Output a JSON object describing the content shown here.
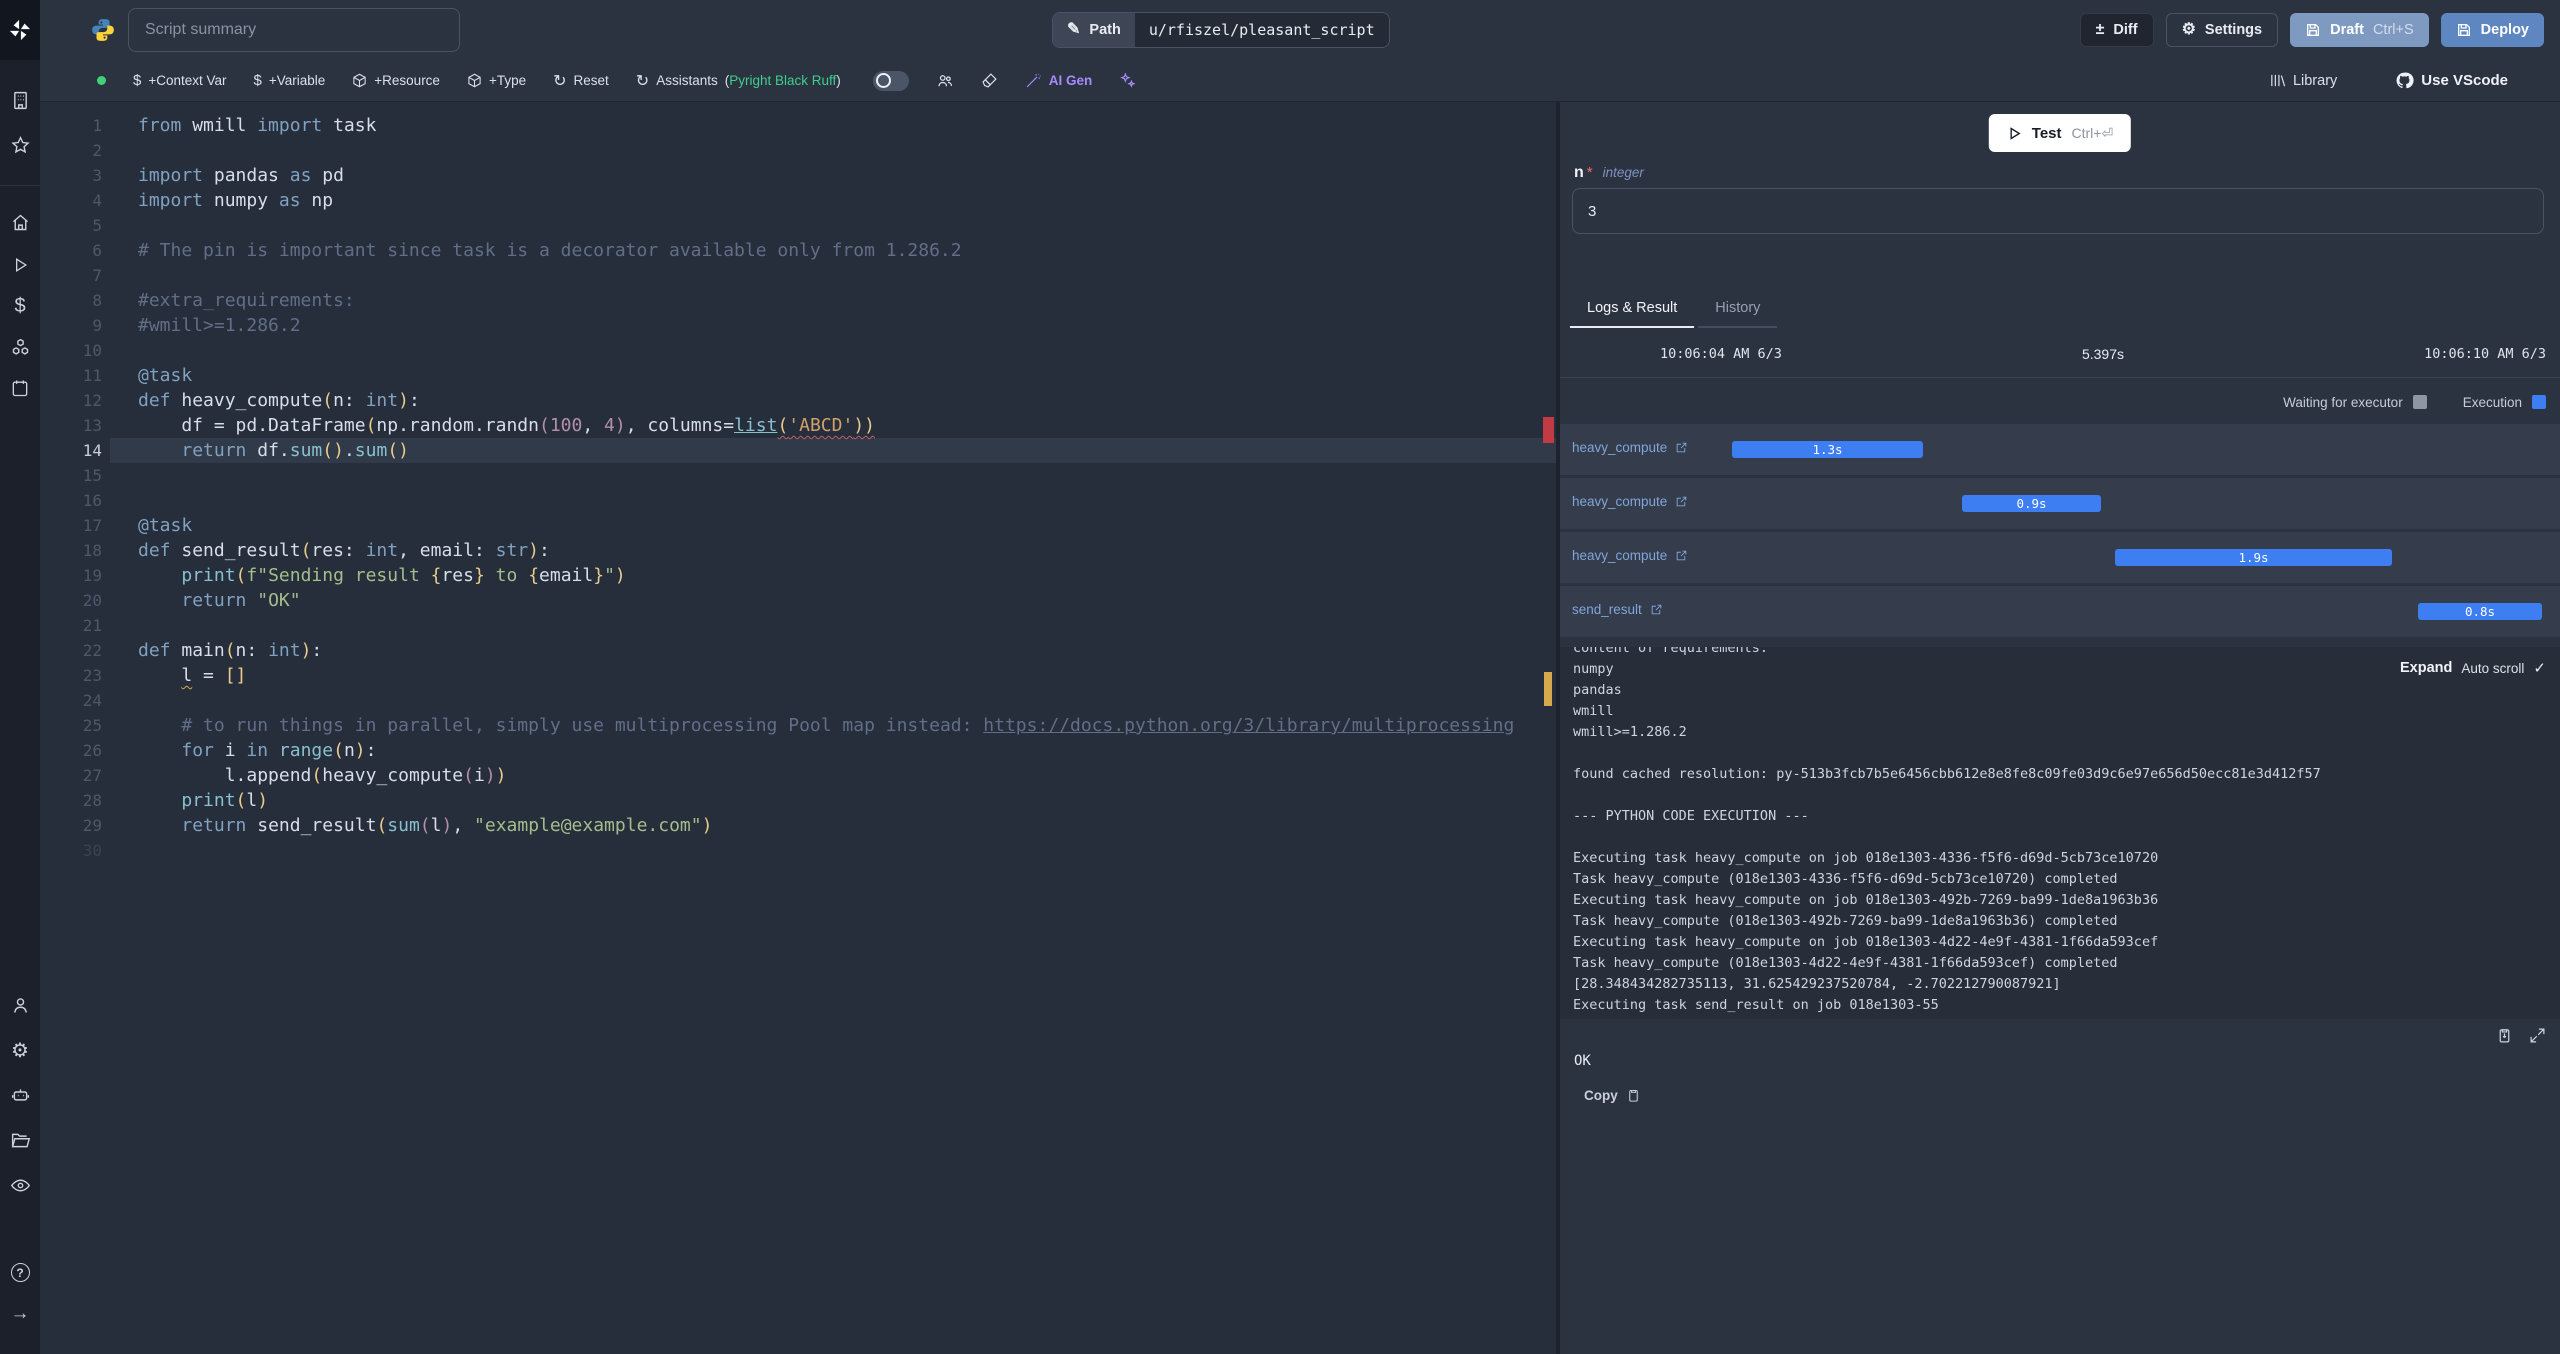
{
  "header": {
    "title_placeholder": "Script summary",
    "path_label": "Path",
    "path_value": "u/rfiszel/pleasant_script",
    "diff_label": "Diff",
    "settings_label": "Settings",
    "draft_label": "Draft",
    "draft_shortcut": "Ctrl+S",
    "deploy_label": "Deploy"
  },
  "toolbar": {
    "context_var": "+Context Var",
    "variable": "+Variable",
    "resource": "+Resource",
    "type": "+Type",
    "reset": "Reset",
    "assistants": "Assistants",
    "assistants_open": "(",
    "assistants_note": "Pyright Black Ruff",
    "assistants_close": ")",
    "ai_gen": "AI Gen",
    "library": "Library",
    "use_vscode": "Use VScode"
  },
  "editor": {
    "current_line": 14,
    "dim_lines": [
      30
    ],
    "lines": [
      [
        [
          "k",
          "from"
        ],
        [
          "t",
          " wmill "
        ],
        [
          "k",
          "import"
        ],
        [
          "t",
          " task"
        ]
      ],
      [],
      [
        [
          "k",
          "import"
        ],
        [
          "t",
          " pandas "
        ],
        [
          "k",
          "as"
        ],
        [
          "t",
          " pd"
        ]
      ],
      [
        [
          "k",
          "import"
        ],
        [
          "t",
          " numpy "
        ],
        [
          "k",
          "as"
        ],
        [
          "t",
          " np"
        ]
      ],
      [],
      [
        [
          "c",
          "# The pin is important since task is a decorator available only from 1.286.2"
        ]
      ],
      [],
      [
        [
          "c",
          "#extra_requirements:"
        ]
      ],
      [
        [
          "c",
          "#wmill>=1.286.2"
        ]
      ],
      [],
      [
        [
          "d",
          "@task"
        ]
      ],
      [
        [
          "k",
          "def"
        ],
        [
          "t",
          " heavy_compute"
        ],
        [
          "y",
          "("
        ],
        [
          "t",
          "n: "
        ],
        [
          "k",
          "int"
        ],
        [
          "y",
          ")"
        ],
        [
          "t",
          ":"
        ]
      ],
      [
        [
          "t",
          "    df = pd.DataFrame"
        ],
        [
          "y",
          "("
        ],
        [
          "t",
          "np.random.randn"
        ],
        [
          "p",
          "("
        ],
        [
          "n",
          "100"
        ],
        [
          "t",
          ", "
        ],
        [
          "n",
          "4"
        ],
        [
          "p",
          ")"
        ],
        [
          "t",
          ", columns="
        ],
        [
          "lk",
          "list"
        ],
        [
          "y sqr",
          "("
        ],
        [
          "o sqr",
          "'ABCD'"
        ],
        [
          "y sqr",
          "))"
        ]
      ],
      [
        [
          "t",
          "    "
        ],
        [
          "k",
          "return"
        ],
        [
          "t",
          " df."
        ],
        [
          "f",
          "sum"
        ],
        [
          "y",
          "()"
        ],
        [
          "t",
          "."
        ],
        [
          "f",
          "sum"
        ],
        [
          "y",
          "()"
        ]
      ],
      [],
      [],
      [
        [
          "d",
          "@task"
        ]
      ],
      [
        [
          "k",
          "def"
        ],
        [
          "t",
          " send_result"
        ],
        [
          "y",
          "("
        ],
        [
          "t",
          "res: "
        ],
        [
          "k",
          "int"
        ],
        [
          "t",
          ", email: "
        ],
        [
          "k",
          "str"
        ],
        [
          "y",
          ")"
        ],
        [
          "t",
          ":"
        ]
      ],
      [
        [
          "t",
          "    "
        ],
        [
          "f",
          "print"
        ],
        [
          "y",
          "("
        ],
        [
          "s",
          "f\"Sending result "
        ],
        [
          "y",
          "{"
        ],
        [
          "t",
          "res"
        ],
        [
          "y",
          "}"
        ],
        [
          "s",
          " to "
        ],
        [
          "y",
          "{"
        ],
        [
          "t",
          "email"
        ],
        [
          "y",
          "}"
        ],
        [
          "s",
          "\""
        ],
        [
          "y",
          ")"
        ]
      ],
      [
        [
          "t",
          "    "
        ],
        [
          "k",
          "return"
        ],
        [
          "s",
          " \"OK\""
        ]
      ],
      [],
      [
        [
          "k",
          "def"
        ],
        [
          "t",
          " main"
        ],
        [
          "y",
          "("
        ],
        [
          "t",
          "n: "
        ],
        [
          "k",
          "int"
        ],
        [
          "y",
          ")"
        ],
        [
          "t",
          ":"
        ]
      ],
      [
        [
          "t",
          "    "
        ],
        [
          "t sqy",
          "l"
        ],
        [
          "t",
          " = "
        ],
        [
          "y",
          "[]"
        ]
      ],
      [],
      [
        [
          "t",
          "    "
        ],
        [
          "c",
          "# to run things in parallel, simply use multiprocessing Pool map instead: "
        ],
        [
          "u",
          "https://docs.python.org/3/library/multiprocessing"
        ]
      ],
      [
        [
          "t",
          "    "
        ],
        [
          "k",
          "for"
        ],
        [
          "t",
          " i "
        ],
        [
          "k",
          "in"
        ],
        [
          "t",
          " "
        ],
        [
          "f",
          "range"
        ],
        [
          "y",
          "("
        ],
        [
          "t",
          "n"
        ],
        [
          "y",
          ")"
        ],
        [
          "t",
          ":"
        ]
      ],
      [
        [
          "t",
          "        l."
        ],
        [
          "t",
          "append"
        ],
        [
          "y",
          "("
        ],
        [
          "t",
          "heavy_compute"
        ],
        [
          "p",
          "("
        ],
        [
          "t",
          "i"
        ],
        [
          "p",
          ")"
        ],
        [
          "y",
          ")"
        ]
      ],
      [
        [
          "t",
          "    "
        ],
        [
          "f",
          "print"
        ],
        [
          "y",
          "("
        ],
        [
          "t",
          "l"
        ],
        [
          "y",
          ")"
        ]
      ],
      [
        [
          "t",
          "    "
        ],
        [
          "k",
          "return"
        ],
        [
          "t",
          " send_result"
        ],
        [
          "y",
          "("
        ],
        [
          "f",
          "sum"
        ],
        [
          "p",
          "("
        ],
        [
          "t",
          "l"
        ],
        [
          "p",
          ")"
        ],
        [
          "t",
          ", "
        ],
        [
          "s",
          "\"example@example.com\""
        ],
        [
          "y",
          ")"
        ]
      ],
      []
    ]
  },
  "runform": {
    "test_label": "Test",
    "test_shortcut": "Ctrl+⏎",
    "arg_name": "n",
    "arg_required": "*",
    "arg_type": "integer",
    "arg_value": "3"
  },
  "tabs": {
    "logs_result": "Logs & Result",
    "history": "History"
  },
  "run": {
    "start": "10:06:04 AM 6/3",
    "duration": "5.397s",
    "end": "10:06:10 AM 6/3",
    "legend_waiting": "Waiting for executor",
    "legend_execution": "Execution"
  },
  "timeline": [
    {
      "name": "heavy_compute",
      "duration": "1.3s",
      "left_pct": 17.2,
      "width_pct": 19.1
    },
    {
      "name": "heavy_compute",
      "duration": "0.9s",
      "left_pct": 40.2,
      "width_pct": 13.9
    },
    {
      "name": "heavy_compute",
      "duration": "1.9s",
      "left_pct": 55.5,
      "width_pct": 27.7
    },
    {
      "name": "send_result",
      "duration": "0.8s",
      "left_pct": 85.8,
      "width_pct": 12.4
    }
  ],
  "logs": {
    "expand_label": "Expand",
    "autoscroll_label": "Auto scroll",
    "autoscroll_check": "✓",
    "lines": [
      "content of requirements:",
      "numpy",
      "pandas",
      "wmill",
      "wmill>=1.286.2",
      "",
      "found cached resolution: py-513b3fcb7b5e6456cbb612e8e8fe8c09fe03d9c6e97e656d50ecc81e3d412f57",
      "",
      "--- PYTHON CODE EXECUTION ---",
      "",
      "Executing task heavy_compute on job 018e1303-4336-f5f6-d69d-5cb73ce10720",
      "Task heavy_compute (018e1303-4336-f5f6-d69d-5cb73ce10720) completed",
      "Executing task heavy_compute on job 018e1303-492b-7269-ba99-1de8a1963b36",
      "Task heavy_compute (018e1303-492b-7269-ba99-1de8a1963b36) completed",
      "Executing task heavy_compute on job 018e1303-4d22-4e9f-4381-1f66da593cef",
      "Task heavy_compute (018e1303-4d22-4e9f-4381-1f66da593cef) completed",
      "[28.348434282735113, 31.625429237520784, -2.702212790087921]",
      "Executing task send_result on job 018e1303-55"
    ]
  },
  "result": {
    "value": "OK",
    "copy_label": "Copy"
  },
  "colors": {
    "execution_blue": "#3d7ef2",
    "waiting_gray": "#8f96a3",
    "accent_green": "#41d07a",
    "ai_purple": "#a78bfa",
    "error_red": "#c23b44",
    "warning_yellow": "#d7a94e"
  }
}
